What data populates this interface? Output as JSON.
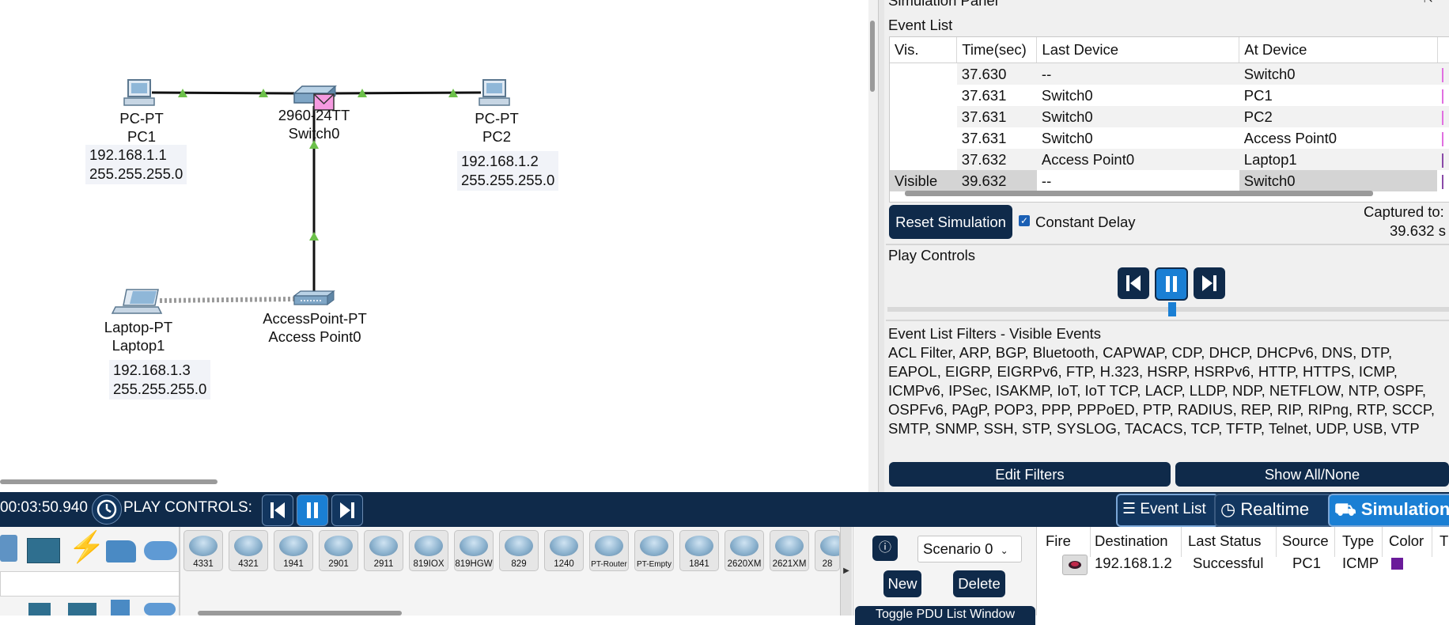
{
  "topology": {
    "pc1": {
      "type": "PC-PT",
      "name": "PC1",
      "ip": "192.168.1.1",
      "mask": "255.255.255.0"
    },
    "switch": {
      "type": "2960-24TT",
      "name": "Switch0"
    },
    "pc2": {
      "type": "PC-PT",
      "name": "PC2",
      "ip": "192.168.1.2",
      "mask": "255.255.255.0"
    },
    "laptop": {
      "type": "Laptop-PT",
      "name": "Laptop1",
      "ip": "192.168.1.3",
      "mask": "255.255.255.0"
    },
    "ap": {
      "type": "AccessPoint-PT",
      "name": "Access Point0"
    }
  },
  "sim_panel": {
    "header_title": "Simulation Panel",
    "event_list_title": "Event List",
    "columns": [
      "Vis.",
      "Time(sec)",
      "Last Device",
      "At Device"
    ],
    "events": [
      {
        "vis": "",
        "time": "37.630",
        "last": "--",
        "at": "Switch0",
        "mark": "#e070e0"
      },
      {
        "vis": "",
        "time": "37.631",
        "last": "Switch0",
        "at": "PC1",
        "mark": "#e070e0"
      },
      {
        "vis": "",
        "time": "37.631",
        "last": "Switch0",
        "at": "PC2",
        "mark": "#e070e0"
      },
      {
        "vis": "",
        "time": "37.631",
        "last": "Switch0",
        "at": "Access Point0",
        "mark": "#e070e0"
      },
      {
        "vis": "",
        "time": "37.632",
        "last": "Access Point0",
        "at": "Laptop1",
        "mark": "#8a4aa8"
      },
      {
        "vis": "Visible",
        "time": "39.632",
        "last": "--",
        "at": "Switch0",
        "mark": "#8a4aa8"
      }
    ],
    "reset_label": "Reset Simulation",
    "constant_delay_label": "Constant Delay",
    "constant_delay_checked": true,
    "captured_label": "Captured to:",
    "captured_value": "39.632 s",
    "play_controls_title": "Play Controls",
    "playback_position": 0.5,
    "filters_title": "Event List Filters - Visible Events",
    "filters_text": "ACL Filter, ARP, BGP, Bluetooth, CAPWAP, CDP, DHCP, DHCPv6, DNS, DTP, EAPOL, EIGRP, EIGRPv6, FTP, H.323, HSRP, HSRPv6, HTTP, HTTPS, ICMP, ICMPv6, IPSec, ISAKMP, IoT, IoT TCP, LACP, LLDP, NDP, NETFLOW, NTP, OSPF, OSPFv6, PAgP, POP3, PPP, PPPoED, PTP, RADIUS, REP, RIP, RIPng, RTP, SCCP, SMTP, SNMP, SSH, STP, SYSLOG, TACACS, TCP, TFTP, Telnet, UDP, USB, VTP",
    "edit_filters_label": "Edit Filters",
    "show_all_label": "Show All/None"
  },
  "bottom_bar": {
    "time": "00:03:50.940",
    "play_controls_label": "PLAY CONTROLS:",
    "event_list_btn": "Event List",
    "realtime_btn": "Realtime",
    "simulation_btn": "Simulation"
  },
  "palette": {
    "devices": [
      "4331",
      "4321",
      "1941",
      "2901",
      "2911",
      "819IOX",
      "819HGW",
      "829",
      "1240",
      "PT-Router",
      "PT-Empty",
      "1841",
      "2620XM",
      "2621XM",
      "28"
    ]
  },
  "scenario": {
    "selected": "Scenario 0",
    "new_label": "New",
    "delete_label": "Delete",
    "pdu_window_label": "Toggle PDU List Window"
  },
  "pdu_table": {
    "columns": [
      "Fire",
      "Destination",
      "Last Status",
      "Source",
      "Type",
      "Color",
      "T"
    ],
    "rows": [
      {
        "destination": "192.168.1.2",
        "status": "Successful",
        "source": "PC1",
        "type": "ICMP",
        "color": "#6a1b9a"
      }
    ]
  }
}
